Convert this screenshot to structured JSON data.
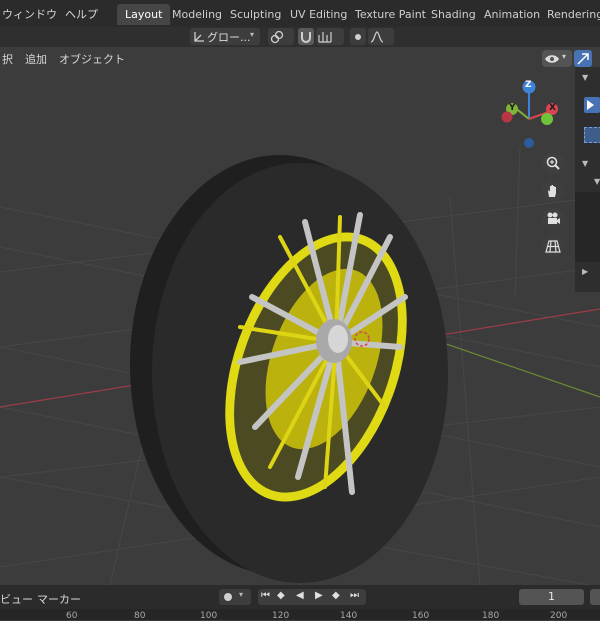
{
  "top_menu": {
    "window": "ウィンドウ",
    "help": "ヘルプ"
  },
  "workspace_tabs": [
    "Layout",
    "Modeling",
    "Sculpting",
    "UV Editing",
    "Texture Paint",
    "Shading",
    "Animation",
    "Rendering"
  ],
  "active_tab": "Layout",
  "header_tools": {
    "transform_orientation": "グロー..."
  },
  "viewport_menu": {
    "select_partial": "択",
    "add": "追加",
    "object": "オブジェクト"
  },
  "gizmo": {
    "z": "Z",
    "y": "Y",
    "x": "X"
  },
  "timeline": {
    "view_partial": "ビュー",
    "marker": "マーカー",
    "current_frame": "1"
  },
  "ruler_ticks": [
    "60",
    "80",
    "100",
    "120",
    "140",
    "160",
    "180",
    "200"
  ],
  "colors": {
    "rim": "#e6e017",
    "tire": "#262626",
    "spokes": "#b8b8b8",
    "x_axis": "#d94452",
    "y_axis": "#7fb33a",
    "z_axis": "#3f83d6",
    "accent": "#4772b3"
  }
}
